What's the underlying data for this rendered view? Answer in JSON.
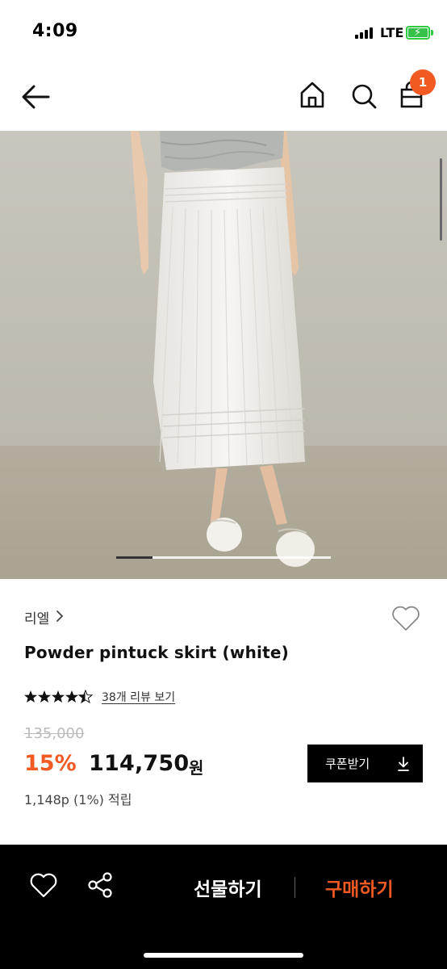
{
  "status_bar": {
    "time": "4:09",
    "network": "LTE",
    "battery_icon": "battery-charging-icon",
    "signal_icon": "cellular-signal-icon"
  },
  "nav": {
    "back_icon": "arrow-left-icon",
    "home_icon": "home-icon",
    "search_icon": "search-icon",
    "cart_icon": "shopping-bag-icon",
    "cart_badge": "1"
  },
  "colors": {
    "accent": "#f15a22",
    "bottom_bar": "#000000",
    "coupon_button": "#000000"
  },
  "gallery": {
    "image_subject": "white pleated midi skirt with pintuck details",
    "carousel_position": 1
  },
  "product": {
    "brand": "리엘",
    "name": "Powder pintuck skirt (white)",
    "rating": 4.5,
    "review_link": "38개 리뷰 보기",
    "original_price": "135,000",
    "discount": "15%",
    "price": "114,750",
    "currency": "원",
    "points": "1,148p (1%) 적립",
    "coupon_button": "쿠폰받기",
    "coupon_icon": "download-icon",
    "wishlist_icon": "heart-outline-icon"
  },
  "bottom_bar": {
    "wish_icon": "heart-outline-icon",
    "share_icon": "share-icon",
    "gift_label": "선물하기",
    "buy_label": "구매하기"
  }
}
